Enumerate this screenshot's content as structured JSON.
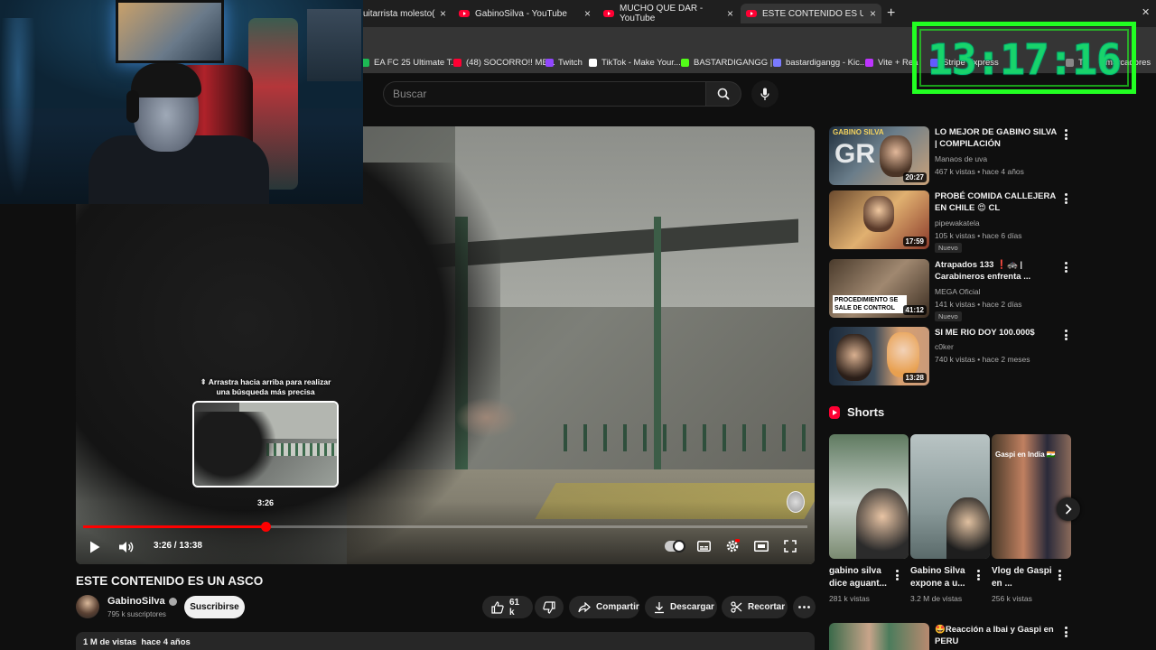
{
  "browser": {
    "tabs": [
      {
        "title": "uitarrista molesto(Co",
        "active": false
      },
      {
        "title": "GabinoSilva - YouTube",
        "active": false
      },
      {
        "title": "MUCHO QUE DAR - YouTube",
        "active": false
      },
      {
        "title": "ESTE CONTENIDO ES UN ASCO",
        "active": true
      }
    ],
    "close_glyph": "×",
    "new_tab_glyph": "+",
    "bookmarks": [
      {
        "label": "EA FC 25 Ultimate T...",
        "color": "#1db954"
      },
      {
        "label": "(48) SOCORRO!! ME...",
        "color": "#ff0033"
      },
      {
        "label": "Twitch",
        "color": "#9146ff"
      },
      {
        "label": "TikTok - Make Your...",
        "color": "#ffffff"
      },
      {
        "label": "BASTARDIGANGG |...",
        "color": "#53fc18"
      },
      {
        "label": "bastardigangg - Kic...",
        "color": "#7a7aff"
      },
      {
        "label": "Vite + Rea",
        "color": "#bd34fe"
      },
      {
        "label": "Stripe Express",
        "color": "#635bff"
      },
      {
        "label": "To",
        "color": "#888888"
      },
      {
        "label": "marcadores",
        "color": "#888888"
      }
    ]
  },
  "search": {
    "placeholder": "Buscar"
  },
  "player": {
    "preview_hint": "⇞ Arrastra hacia arriba para realizar una búsqueda más precisa",
    "preview_time": "3:26",
    "current_time": "3:26",
    "duration": "13:38",
    "timecode": "3:26 / 13:38",
    "progress_fraction": 0.252
  },
  "video": {
    "title": "ESTE CONTENIDO ES UN ASCO",
    "channel": "GabinoSilva",
    "subscribers": "795 k suscriptores",
    "subscribe_label": "Suscribirse",
    "likes": "61 k",
    "share_label": "Compartir",
    "download_label": "Descargar",
    "clip_label": "Recortar",
    "views_date": "1 M de vistas  hace 4 años"
  },
  "recommendations": [
    {
      "title": "LO MEJOR DE GABINO SILVA | COMPILACIÓN",
      "channel": "Manaos de uva",
      "meta": "467 k vistas • hace 4 años",
      "duration": "20:27",
      "badge": "",
      "thumb_text": "GABINO SILVA",
      "thumb_colors": [
        "#2a3b4c",
        "#c9a27a"
      ]
    },
    {
      "title": "PROBÉ COMIDA CALLEJERA EN CHILE 😍 CL",
      "channel": "pipewakatela",
      "meta": "105 k vistas • hace 6 días",
      "duration": "17:59",
      "badge": "Nuevo",
      "thumb_text": "",
      "thumb_colors": [
        "#7a5a3a",
        "#e0b070"
      ]
    },
    {
      "title": "Atrapados 133 ❗🚓 | Carabineros enfrenta ...",
      "channel": "MEGA Oficial",
      "meta": "141 k vistas • hace 2 días",
      "duration": "41:12",
      "badge": "Nuevo",
      "thumb_text": "PROCEDIMIENTO SE SALE DE CONTROL",
      "thumb_colors": [
        "#5a4a3a",
        "#a08870"
      ]
    },
    {
      "title": "SI ME RIO DOY 100.000$",
      "channel": "c0ker",
      "meta": "740 k vistas • hace 2 meses",
      "duration": "13:28",
      "badge": "",
      "thumb_text": "",
      "thumb_colors": [
        "#1c2a3a",
        "#d8a070"
      ]
    }
  ],
  "shorts": {
    "heading": "Shorts",
    "items": [
      {
        "title": "gabino silva dice aguant...",
        "views": "281 k vistas",
        "colors": [
          "#6a8a6a",
          "#c9d2cc"
        ]
      },
      {
        "title": "Gabino Silva expone a u...",
        "views": "3.2 M de vistas",
        "colors": [
          "#8a9a9a",
          "#d8e0e0"
        ]
      },
      {
        "title": "Vlog de Gaspi en ...",
        "views": "256 k vistas",
        "colors": [
          "#4a3a2a",
          "#c08060"
        ]
      }
    ],
    "third_overlay": "Gaspi en India 🇮🇳"
  },
  "rec_bottom": {
    "title": "🤩Reacción a Ibai y Gaspi en PERU"
  },
  "overlay_clock": {
    "time": "13:17:16"
  },
  "colors": {
    "accent": "#ff0000",
    "clock_green": "#22ff22",
    "background": "#0f0f0f"
  }
}
